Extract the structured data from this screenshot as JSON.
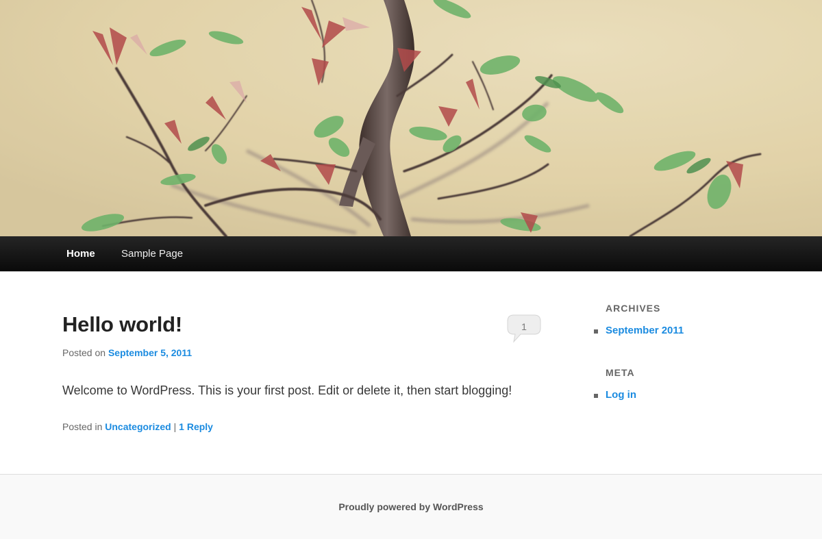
{
  "header": {
    "image": "bonsai-tree-header-photo",
    "colors": {
      "wall": "#e9dcb7",
      "trunk": "#5e4e4a",
      "leaf_green": "#6fb36a",
      "leaf_red": "#b24b4b"
    }
  },
  "nav": {
    "items": [
      {
        "label": "Home",
        "active": true
      },
      {
        "label": "Sample Page",
        "active": false
      }
    ]
  },
  "post": {
    "title": "Hello world!",
    "comment_count": "1",
    "posted_on_label": "Posted on",
    "date": "September 5, 2011",
    "content": "Welcome to WordPress. This is your first post. Edit or delete it, then start blogging!",
    "posted_in_label": "Posted in",
    "category": "Uncategorized",
    "separator": "|",
    "reply_link": "1 Reply"
  },
  "sidebar": {
    "archives": {
      "title": "Archives",
      "items": [
        "September 2011"
      ]
    },
    "meta": {
      "title": "Meta",
      "items": [
        "Log in"
      ]
    }
  },
  "footer": {
    "credit": "Proudly powered by WordPress"
  },
  "colors": {
    "link": "#1b8be0",
    "nav_bg": "#111111",
    "footer_bg": "#f9f9f9"
  }
}
